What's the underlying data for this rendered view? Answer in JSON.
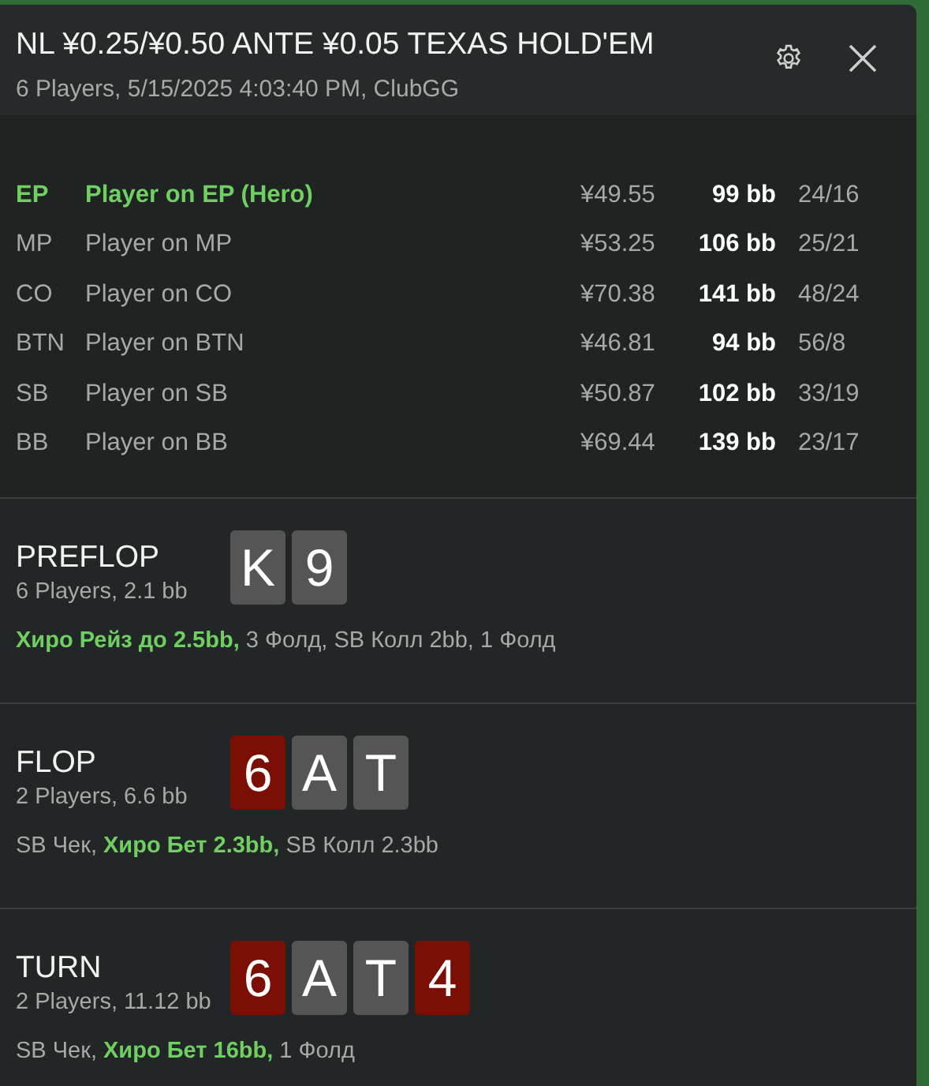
{
  "header": {
    "title": "NL ¥0.25/¥0.50 ANTE ¥0.05 TEXAS HOLD'EM",
    "subtitle": "6 Players, 5/15/2025 4:03:40 PM, ClubGG"
  },
  "players": [
    {
      "position": "EP",
      "name": "Player on EP (Hero)",
      "stack": "¥49.55",
      "bb": "99 bb",
      "stats": "24/16",
      "hero": true
    },
    {
      "position": "MP",
      "name": "Player on MP",
      "stack": "¥53.25",
      "bb": "106 bb",
      "stats": "25/21",
      "hero": false
    },
    {
      "position": "CO",
      "name": "Player on CO",
      "stack": "¥70.38",
      "bb": "141 bb",
      "stats": "48/24",
      "hero": false
    },
    {
      "position": "BTN",
      "name": "Player on BTN",
      "stack": "¥46.81",
      "bb": "94 bb",
      "stats": "56/8",
      "hero": false
    },
    {
      "position": "SB",
      "name": "Player on SB",
      "stack": "¥50.87",
      "bb": "102 bb",
      "stats": "33/19",
      "hero": false
    },
    {
      "position": "BB",
      "name": "Player on BB",
      "stack": "¥69.44",
      "bb": "139 bb",
      "stats": "23/17",
      "hero": false
    }
  ],
  "streets": [
    {
      "name": "PREFLOP",
      "info": "6 Players, 2.1 bb",
      "cards": [
        {
          "rank": "K",
          "color": "#555555"
        },
        {
          "rank": "9",
          "color": "#555555"
        }
      ],
      "actions": "**Хиро Рейз до 2.5bb,** 3 Фолд, SB Колл 2bb, 1 Фолд"
    },
    {
      "name": "FLOP",
      "info": "2 Players, 6.6 bb",
      "cards": [
        {
          "rank": "6",
          "color": "#7b0e05"
        },
        {
          "rank": "A",
          "color": "#555555"
        },
        {
          "rank": "T",
          "color": "#555555"
        }
      ],
      "actions": "SB Чек, **Хиро Бет 2.3bb,** SB Колл 2.3bb"
    },
    {
      "name": "TURN",
      "info": "2 Players, 11.12 bb",
      "cards": [
        {
          "rank": "6",
          "color": "#7b0e05"
        },
        {
          "rank": "A",
          "color": "#555555"
        },
        {
          "rank": "T",
          "color": "#555555"
        },
        {
          "rank": "4",
          "color": "#7b0e05"
        }
      ],
      "actions": "SB Чек, **Хиро Бет 16bb,** 1 Фолд"
    }
  ]
}
